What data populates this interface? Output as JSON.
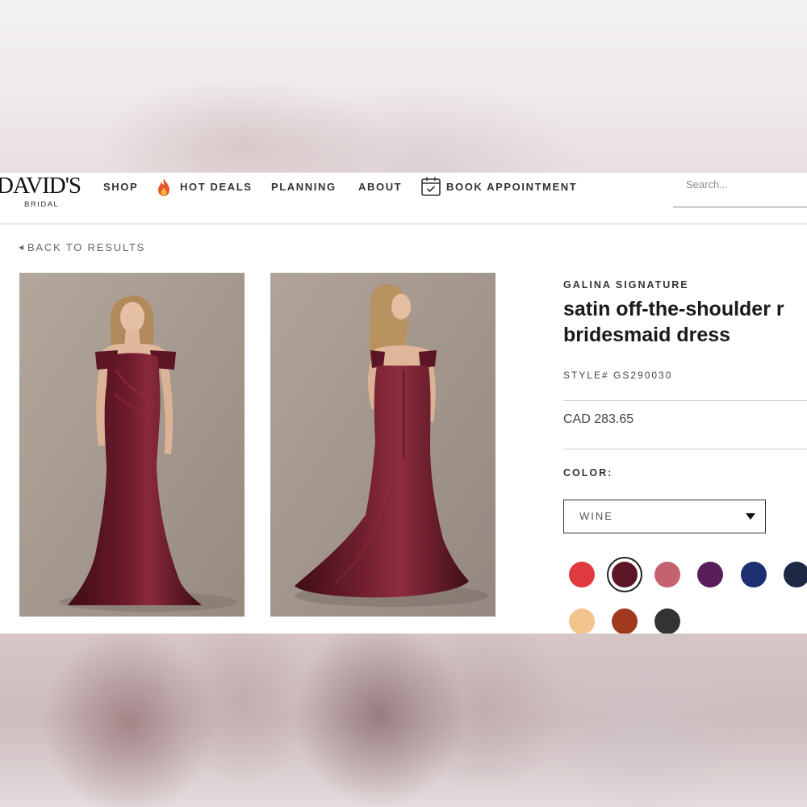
{
  "header": {
    "logo": {
      "main": "DAVID'S",
      "sub": "BRIDAL"
    },
    "nav": [
      {
        "label": "SHOP"
      },
      {
        "label": "HOT DEALS",
        "icon": "flame-icon"
      },
      {
        "label": "PLANNING"
      },
      {
        "label": "ABOUT"
      },
      {
        "label": "BOOK APPOINTMENT",
        "icon": "calendar-check-icon"
      }
    ],
    "search": {
      "placeholder": "Search..."
    }
  },
  "back_link": {
    "label": "BACK TO RESULTS",
    "icon": "caret-left-icon"
  },
  "product": {
    "brand": "GALINA SIGNATURE",
    "title_line1": "satin off-the-shoulder r",
    "title_line2": "bridesmaid dress",
    "style": "STYLE# GS290030",
    "price": "CAD 283.65",
    "color_label": "COLOR:",
    "selected_color": "WINE",
    "images": [
      {
        "alt": "model front view in wine satin off-the-shoulder mermaid gown"
      },
      {
        "alt": "model back view in wine satin off-the-shoulder mermaid gown"
      }
    ],
    "swatches": [
      {
        "color": "#e0393e"
      },
      {
        "color": "#5c1524",
        "selected": true
      },
      {
        "color": "#c4626f"
      },
      {
        "color": "#5a1d5c"
      },
      {
        "color": "#1d2f70"
      },
      {
        "color": "#1c2844"
      },
      {
        "color": "#f3c58e"
      },
      {
        "color": "#a03a1f"
      },
      {
        "color": "#333333"
      }
    ]
  },
  "colors": {
    "accent": "#1a1a1a",
    "dress": "#5c1524",
    "photo_bg": "#a79a8e"
  }
}
